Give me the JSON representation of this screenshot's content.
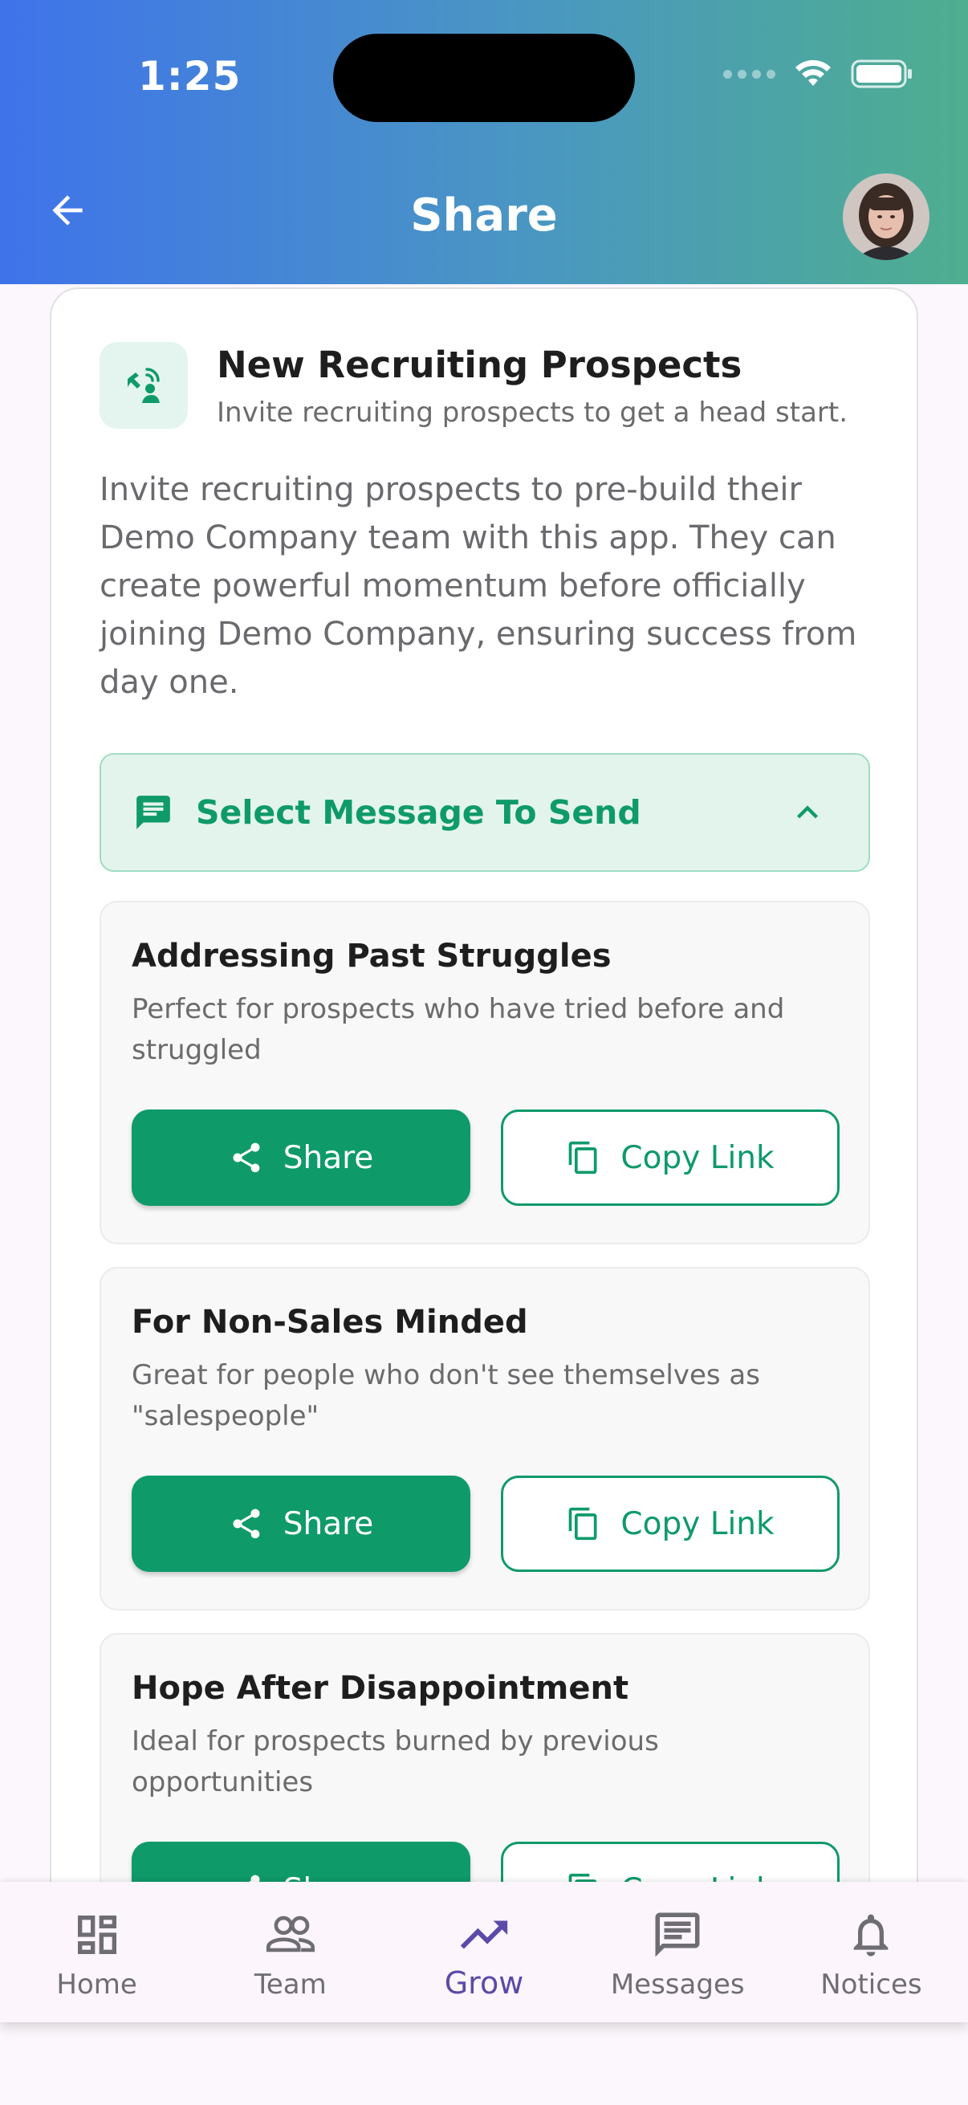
{
  "status_bar": {
    "time": "1:25"
  },
  "header": {
    "title": "Share"
  },
  "program": {
    "title": "New Recruiting Prospects",
    "subtitle": "Invite recruiting prospects to get a head start.",
    "description": "Invite recruiting prospects to pre-build their Demo Company team with this app. They can create powerful momentum before officially joining Demo Company, ensuring success from day one."
  },
  "selector": {
    "label": "Select Message To Send",
    "expanded": true
  },
  "messages": [
    {
      "title": "Addressing Past Struggles",
      "description": "Perfect for prospects who have tried before and struggled",
      "share_label": "Share",
      "copy_label": "Copy Link"
    },
    {
      "title": "For Non-Sales Minded",
      "description": "Great for people who don't see themselves as \"salespeople\"",
      "share_label": "Share",
      "copy_label": "Copy Link"
    },
    {
      "title": "Hope After Disappointment",
      "description": "Ideal for prospects burned by previous opportunities",
      "share_label": "Share",
      "copy_label": "Copy Link"
    }
  ],
  "nav": [
    {
      "label": "Home",
      "icon": "dashboard-icon"
    },
    {
      "label": "Team",
      "icon": "team-icon"
    },
    {
      "label": "Grow",
      "icon": "trending-up-icon",
      "active": true
    },
    {
      "label": "Messages",
      "icon": "message-icon"
    },
    {
      "label": "Notices",
      "icon": "bell-icon"
    }
  ],
  "colors": {
    "primary_green": "#0f9a6a",
    "active_nav": "#5b4aa8",
    "header_start": "#3f73ea",
    "header_end": "#4eae8f"
  }
}
